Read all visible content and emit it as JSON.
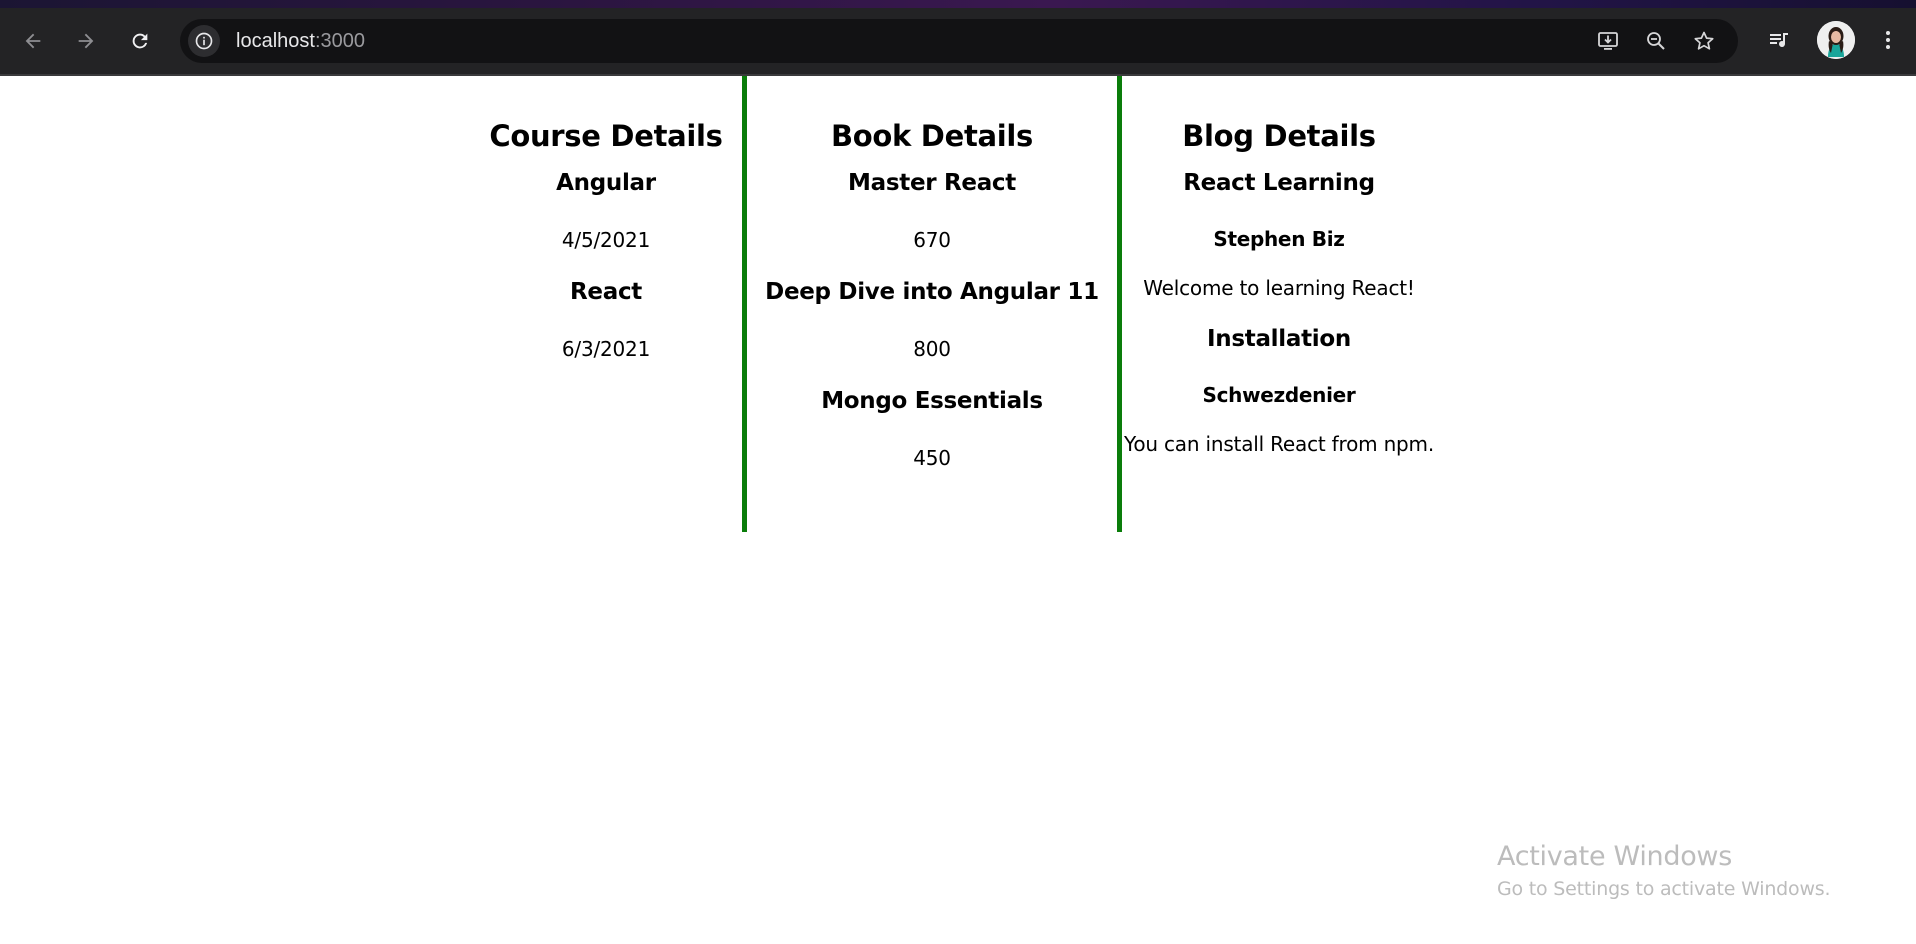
{
  "browser": {
    "url_host": "localhost",
    "url_port": ":3000",
    "icons": {
      "back": "back-arrow-icon",
      "forward": "forward-arrow-icon",
      "reload": "reload-icon",
      "site_info": "info-icon",
      "install": "install-app-icon",
      "zoom": "zoom-out-icon",
      "bookmark": "star-icon",
      "media": "media-controls-icon",
      "menu": "more-vertical-icon"
    }
  },
  "courses": {
    "title": "Course Details",
    "items": [
      {
        "name": "Angular",
        "date": "4/5/2021"
      },
      {
        "name": "React",
        "date": "6/3/2021"
      }
    ]
  },
  "books": {
    "title": "Book Details",
    "items": [
      {
        "name": "Master React",
        "price": "670"
      },
      {
        "name": "Deep Dive into Angular 11",
        "price": "800"
      },
      {
        "name": "Mongo Essentials",
        "price": "450"
      }
    ]
  },
  "blogs": {
    "title": "Blog Details",
    "items": [
      {
        "title": "React Learning",
        "author": "Stephen Biz",
        "content": "Welcome to learning React!"
      },
      {
        "title": "Installation",
        "author": "Schwezdenier",
        "content": "You can install React from npm."
      }
    ]
  },
  "watermark": {
    "title": "Activate Windows",
    "subtitle": "Go to Settings to activate Windows."
  },
  "colors": {
    "divider": "#0a7d0a",
    "chrome_bg": "#232325"
  }
}
